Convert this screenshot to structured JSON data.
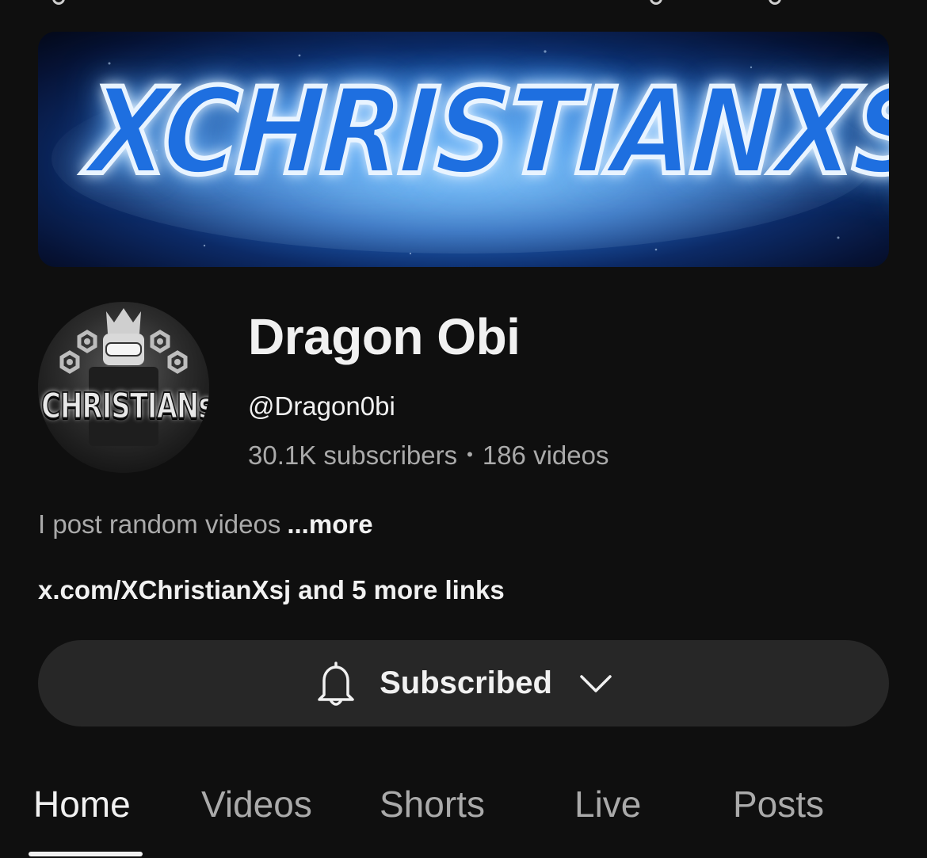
{
  "banner": {
    "text": "XCHRISTIANXSJ"
  },
  "avatar": {
    "text": "CHRISTIANs"
  },
  "channel": {
    "name": "Dragon Obi",
    "handle": "@Dragon0bi",
    "subscribers": "30.1K subscribers",
    "separator": "•",
    "videos": "186 videos"
  },
  "description": {
    "text": "I post random videos",
    "more": "...more"
  },
  "links": {
    "text": "x.com/XChristianXsj and 5 more links"
  },
  "subscribe": {
    "label": "Subscribed",
    "icon": "bell-icon",
    "dropdown_icon": "chevron-down-icon"
  },
  "tabs": [
    {
      "label": "Home",
      "active": true
    },
    {
      "label": "Videos",
      "active": false
    },
    {
      "label": "Shorts",
      "active": false
    },
    {
      "label": "Live",
      "active": false
    },
    {
      "label": "Posts",
      "active": false
    }
  ]
}
